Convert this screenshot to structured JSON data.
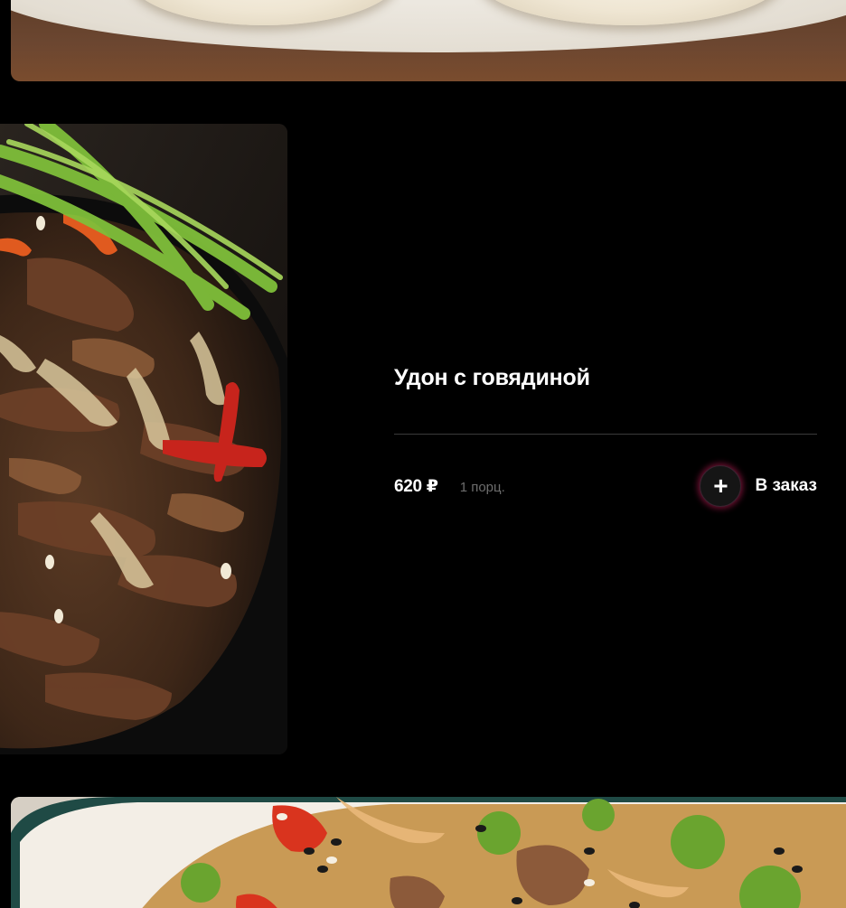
{
  "dish": {
    "title": "Удон с говядиной",
    "price": "620 ₽",
    "portion": "1 порц.",
    "add_label": "В заказ",
    "add_icon": "plus-icon"
  },
  "colors": {
    "background": "#000000",
    "text": "#ffffff",
    "muted_text": "#6d6d6d",
    "divider": "#3a3a3a",
    "button_glow": "#c81e5a"
  }
}
